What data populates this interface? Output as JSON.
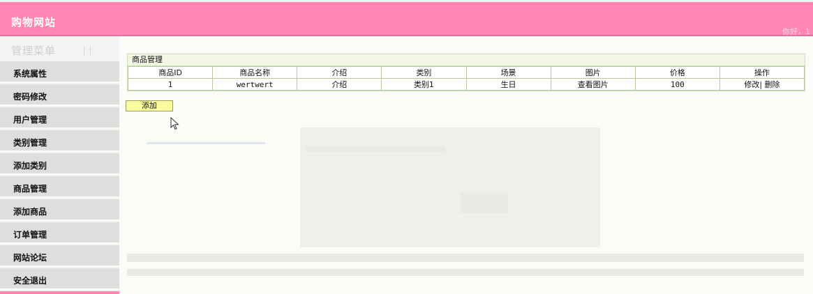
{
  "header": {
    "site_title": "购物网站",
    "greeting": "你好，1"
  },
  "sidebar": {
    "title": "管理菜单",
    "items": [
      {
        "label": "系统属性"
      },
      {
        "label": "密码修改"
      },
      {
        "label": "用户管理"
      },
      {
        "label": "类别管理"
      },
      {
        "label": "添加类别"
      },
      {
        "label": "商品管理"
      },
      {
        "label": "添加商品"
      },
      {
        "label": "订单管理"
      },
      {
        "label": "网站论坛"
      },
      {
        "label": "安全退出"
      }
    ]
  },
  "panel": {
    "title": "商品管理",
    "columns": [
      "商品ID",
      "商品名称",
      "介绍",
      "类别",
      "场景",
      "图片",
      "价格",
      "操作"
    ],
    "rows": [
      {
        "id": "1",
        "name": "wertwert",
        "intro": "介绍",
        "category": "类别1",
        "scene": "生日",
        "image": "查看图片",
        "price": "100",
        "edit": "修改",
        "separator": "|",
        "delete": "删除"
      }
    ],
    "add_button": "添加"
  },
  "colors": {
    "header_pink": "#ff85b2",
    "panel_border": "#c9ddb1",
    "add_button_bg": "#fbfb9f"
  }
}
